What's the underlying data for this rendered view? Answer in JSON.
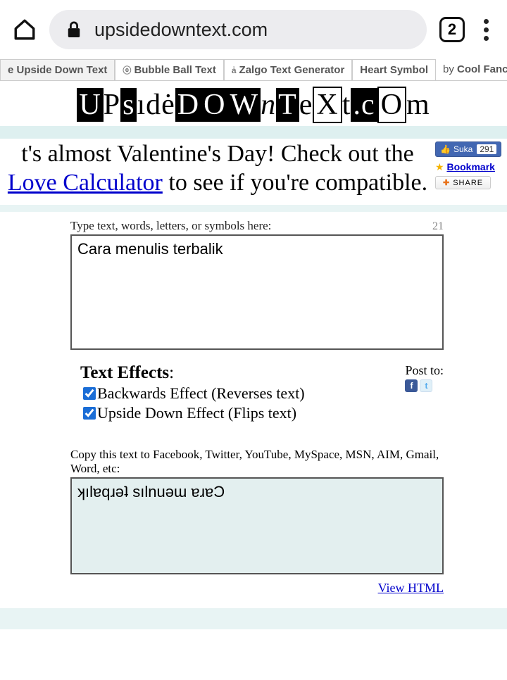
{
  "chrome": {
    "url": "upsidedowntext.com",
    "tab_count": "2"
  },
  "tabs": {
    "t0": "e Upside Down Text",
    "t1": "Bubble Ball Text",
    "t2": "Zalgo Text Generator",
    "t3": "Heart Symbol",
    "by_prefix": "by ",
    "by_link": "Cool Fancy Text Generator"
  },
  "sidebar": {
    "fb_label": "Suka",
    "fb_count": "291",
    "bookmark": "Bookmark",
    "share": "SHARE"
  },
  "promo": {
    "line1": "t's almost Valentine's Day! Check out the ",
    "link": "Love Calculator",
    "line2": " to see if you're compatible."
  },
  "form": {
    "input_label": "Type text, words, letters, or symbols here:",
    "char_count": "21",
    "input_value": "Cara menulis terbalik",
    "effects_heading": "Text Effects",
    "opt_backwards": "Backwards Effect (Reverses text)",
    "opt_upside": "Upside Down Effect (Flips text)",
    "backwards_checked": true,
    "upside_checked": true,
    "post_to": "Post to:",
    "output_label": "Copy this text to Facebook, Twitter, YouTube, MySpace, MSN, AIM, Gmail, Word, etc:",
    "output_value": "ʞılɐqɹǝʇ sılnuǝɯ ɐɹɐϽ",
    "view_html": "View HTML"
  }
}
